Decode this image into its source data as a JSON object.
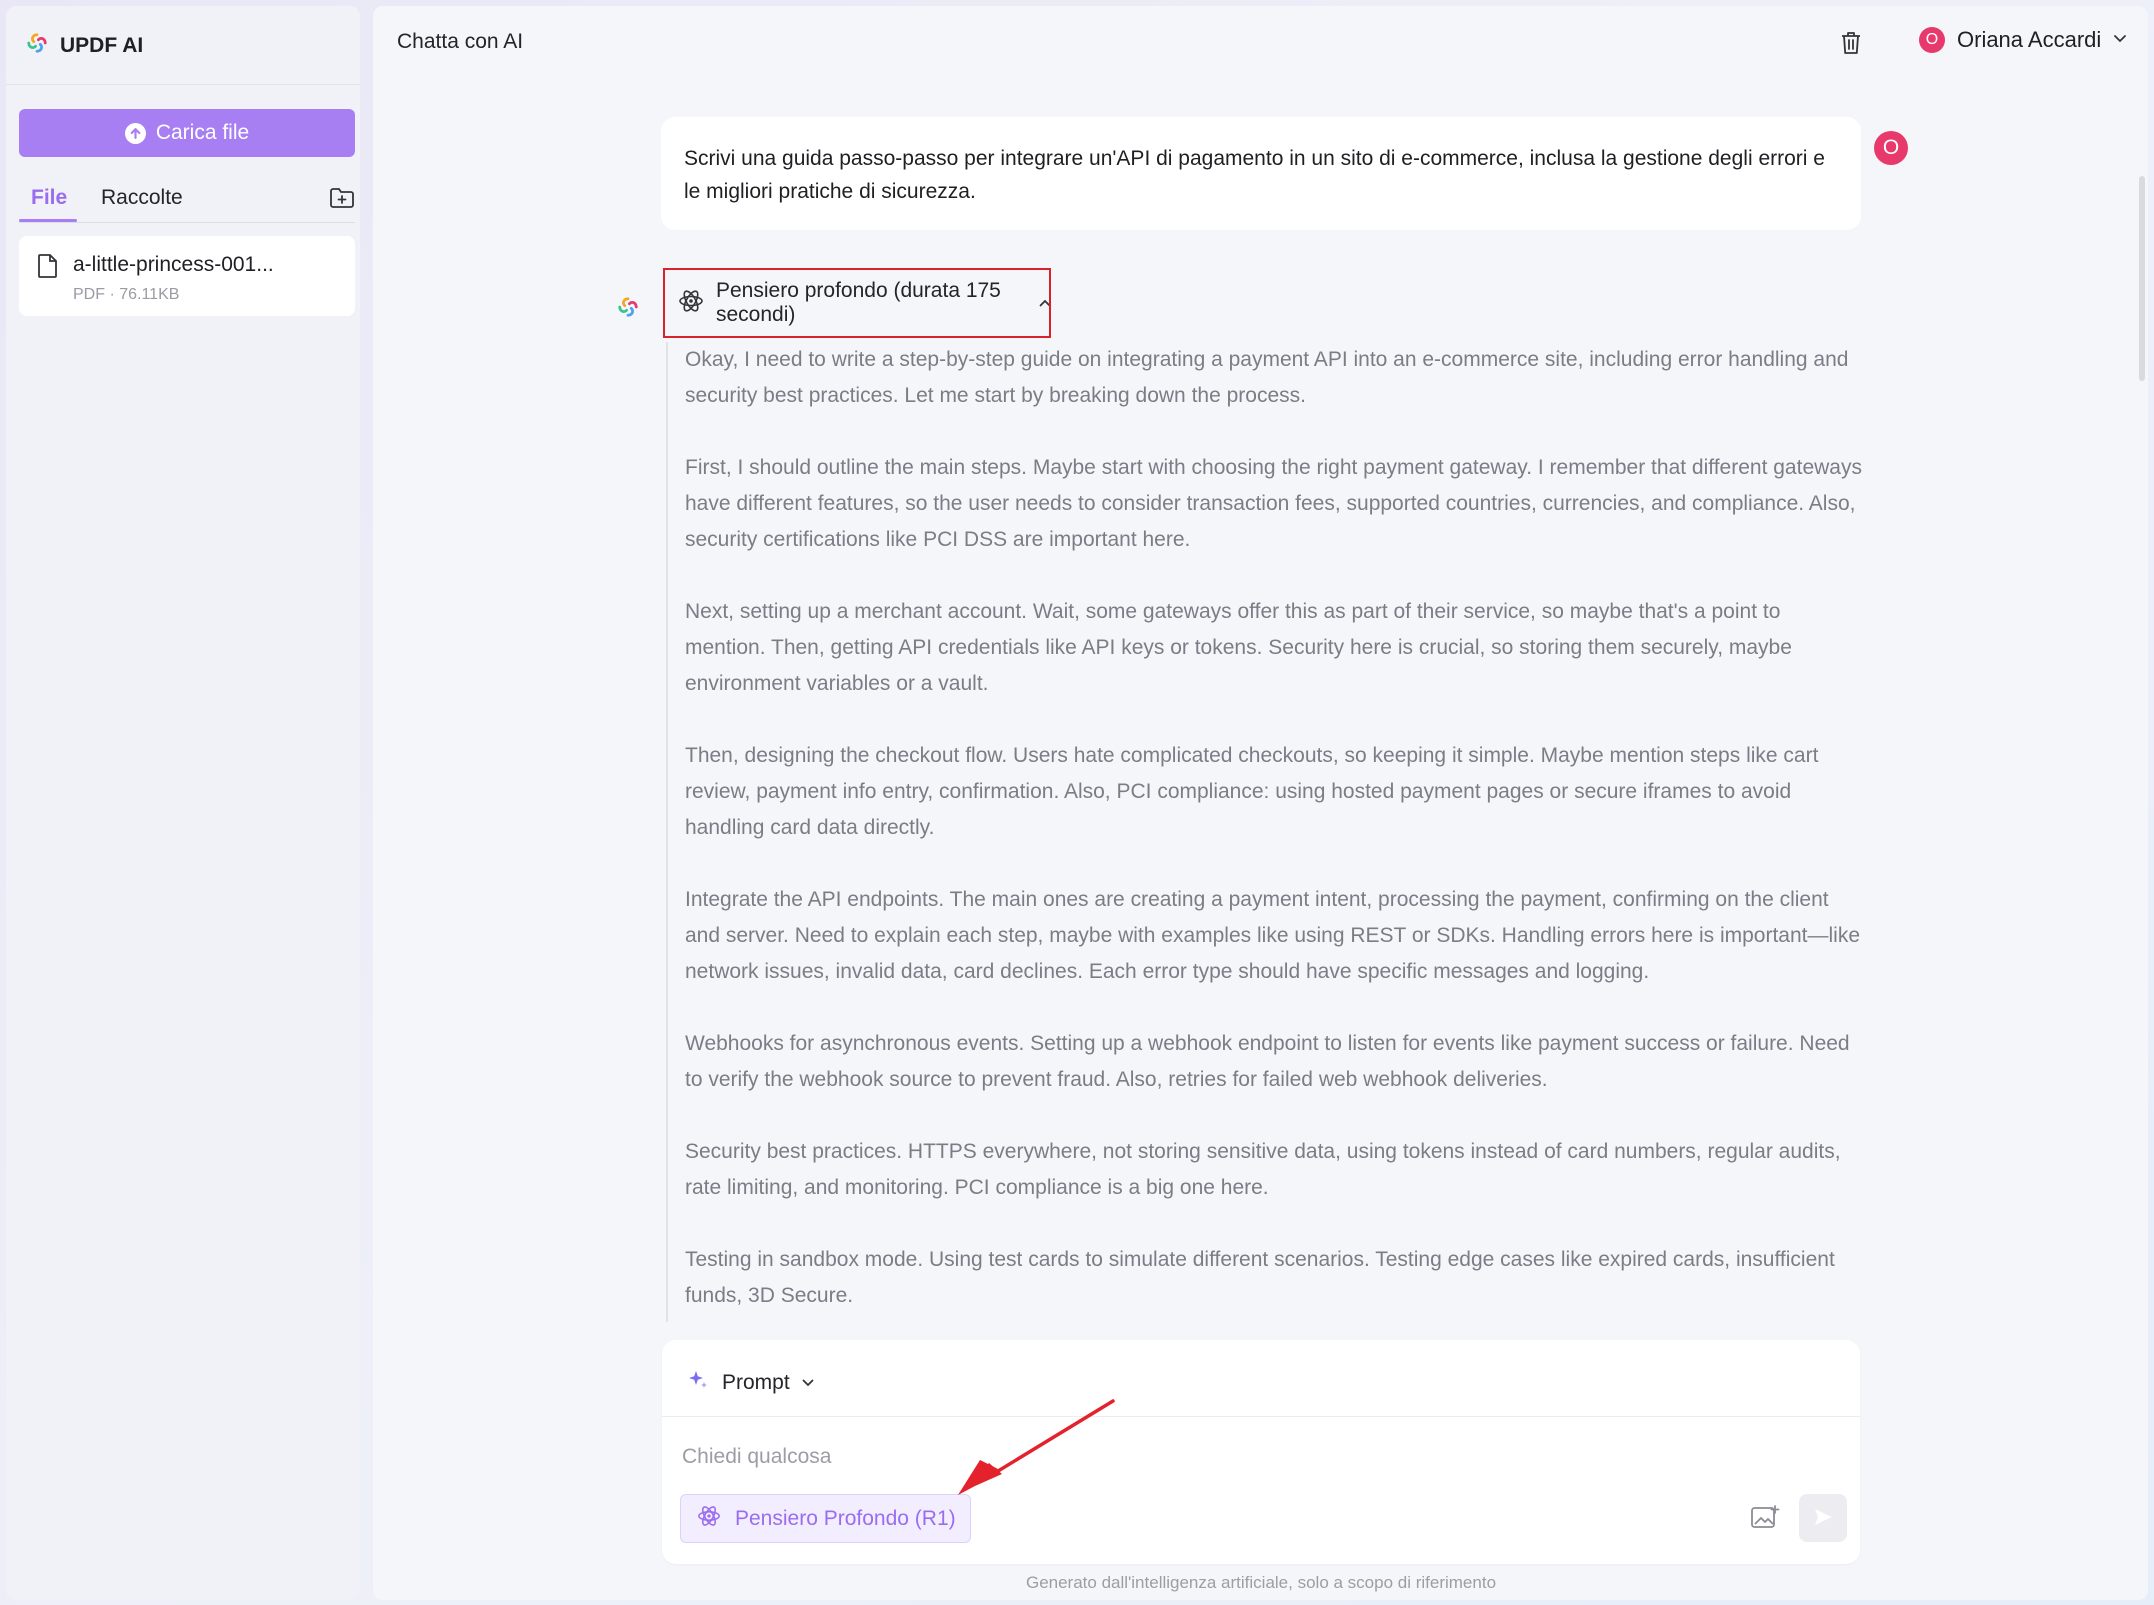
{
  "app": {
    "brand_title": "UPDF AI"
  },
  "sidebar": {
    "upload_label": "Carica file",
    "tabs": [
      {
        "label": "File",
        "active": true
      },
      {
        "label": "Raccolte",
        "active": false
      }
    ],
    "files": [
      {
        "name": "a-little-princess-001...",
        "meta": "PDF · 76.11KB"
      }
    ]
  },
  "header": {
    "title": "Chatta con AI",
    "user_initial": "O",
    "user_name": "Oriana Accardi"
  },
  "chat": {
    "user_message": "Scrivi una guida passo-passo per integrare un'API di pagamento in un sito di e-commerce, inclusa la gestione degli errori e le migliori pratiche di sicurezza.",
    "user_avatar": "O",
    "thinking_label": "Pensiero profondo (durata 175 secondi)",
    "thinking_paragraphs": [
      "Okay, I need to write a step-by-step guide on integrating a payment API into an e-commerce site, including error handling and security best practices. Let me start by breaking down the process.",
      "First, I should outline the main steps. Maybe start with choosing the right payment gateway. I remember that different gateways have different features, so the user needs to consider transaction fees, supported countries, currencies, and compliance. Also, security certifications like PCI DSS are important here.",
      "Next, setting up a merchant account. Wait, some gateways offer this as part of their service, so maybe that's a point to mention. Then, getting API credentials like API keys or tokens. Security here is crucial, so storing them securely, maybe environment variables or a vault.",
      "Then, designing the checkout flow. Users hate complicated checkouts, so keeping it simple. Maybe mention steps like cart review, payment info entry, confirmation. Also, PCI compliance: using hosted payment pages or secure iframes to avoid handling card data directly.",
      "Integrate the API endpoints. The main ones are creating a payment intent, processing the payment, confirming on the client and server. Need to explain each step, maybe with examples like using REST or SDKs. Handling errors here is important—like network issues, invalid data, card declines. Each error type should have specific messages and logging.",
      "Webhooks for asynchronous events. Setting up a webhook endpoint to listen for events like payment success or failure. Need to verify the webhook source to prevent fraud. Also, retries for failed web webhook deliveries.",
      "Security best practices. HTTPS everywhere, not storing sensitive data, using tokens instead of card numbers, regular audits, rate limiting, and monitoring. PCI compliance is a big one here.",
      "Testing in sandbox mode. Using test cards to simulate different scenarios. Testing edge cases like expired cards, insufficient funds, 3D Secure."
    ]
  },
  "composer": {
    "prompt_label": "Prompt",
    "input_value": "",
    "input_placeholder": "Chiedi qualcosa",
    "deep_thinking_label": "Pensiero Profondo (R1)",
    "footer_note": "Generato dall'intelligenza artificiale, solo a scopo di riferimento"
  },
  "colors": {
    "accent": "#a77ff3",
    "accent_text": "#9a6df0",
    "avatar": "#e7396b",
    "annotation": "#d9222c"
  }
}
